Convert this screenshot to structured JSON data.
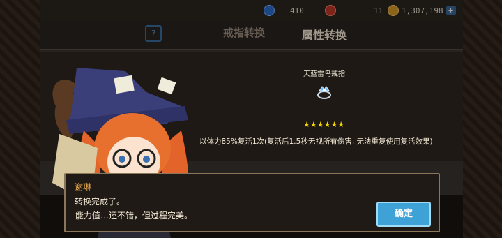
{
  "resources": {
    "gems": "410",
    "hearts": "11",
    "gold": "1,307,198"
  },
  "header": {
    "tab_ring": "戒指转换",
    "tab_attr": "属性转换"
  },
  "item": {
    "name": "天蓝雷鸟戒指",
    "stars": "★★★★★★",
    "star_count": 6,
    "effect": "以体力85%复活1次(复活后1.5秒无视所有伤害, 无法重复使用复活效果)"
  },
  "dialog": {
    "speaker": "谢琳",
    "line1": "转换完成了。",
    "line2": "能力值…还不错，但过程完美。",
    "confirm": "确定"
  },
  "colors": {
    "star": "#f5d200",
    "speaker": "#e8a94a",
    "confirm_bg": "#3ea2d6"
  }
}
